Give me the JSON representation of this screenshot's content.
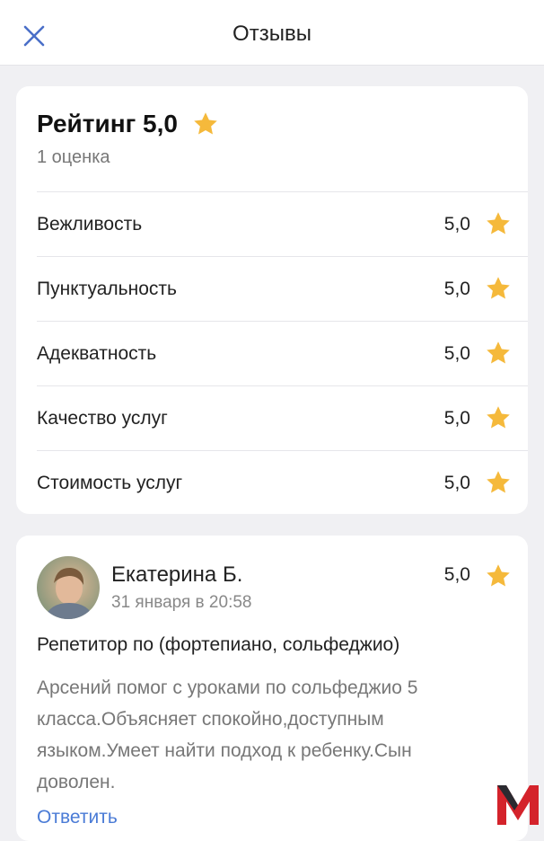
{
  "header": {
    "title": "Отзывы",
    "close_icon": "close-icon"
  },
  "rating": {
    "title": "Рейтинг 5,0",
    "count_text": "1 оценка",
    "criteria": [
      {
        "label": "Вежливость",
        "value": "5,0"
      },
      {
        "label": "Пунктуальность",
        "value": "5,0"
      },
      {
        "label": "Адекватность",
        "value": "5,0"
      },
      {
        "label": "Качество услуг",
        "value": "5,0"
      },
      {
        "label": "Стоимость услуг",
        "value": "5,0"
      }
    ]
  },
  "review": {
    "author": "Екатерина Б.",
    "date": "31 января в 20:58",
    "value": "5,0",
    "service": "Репетитор по (фортепиано, сольфеджио)",
    "text": "Арсений помог с уроками по сольфеджио 5 класса.Объясняет спокойно,доступным языком.Умеет найти подход к ребенку.Сын доволен.",
    "reply_label": "Ответить"
  },
  "colors": {
    "star": "#f5b93b",
    "link": "#4a7bd6",
    "close": "#4a6fc8",
    "logo_red": "#d4232b",
    "logo_dark": "#2a2a30"
  }
}
